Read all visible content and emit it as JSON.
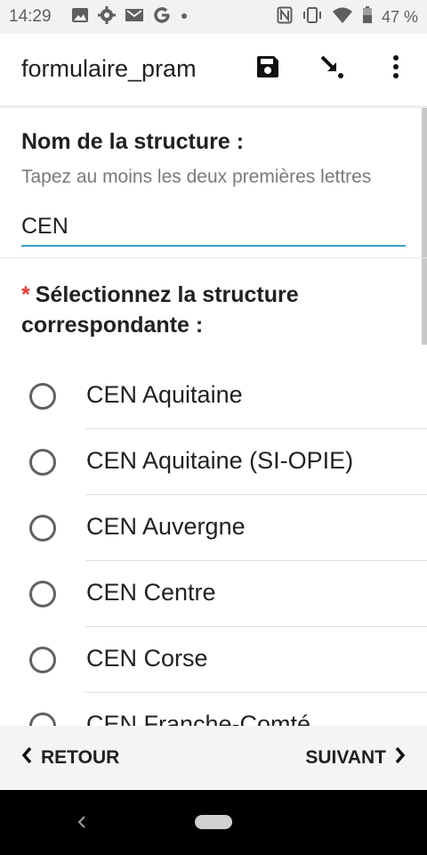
{
  "status_bar": {
    "time": "14:29",
    "battery_percent": "47 %",
    "left_icons": [
      "image-icon",
      "gear-icon",
      "gmail-icon",
      "google-icon",
      "dot-icon"
    ],
    "right_icons": [
      "nfc-icon",
      "vibrate-icon",
      "wifi-icon",
      "battery-icon"
    ]
  },
  "app_bar": {
    "title": "formulaire_pram",
    "actions": [
      "save-icon",
      "jump-to-icon",
      "more-vert-icon"
    ]
  },
  "question1": {
    "label": "Nom de la structure :",
    "hint": "Tapez au moins les deux premières lettres",
    "value": "CEN"
  },
  "question2": {
    "required_marker": "*",
    "label": "Sélectionnez la structure correspondante :",
    "options": [
      {
        "label": "CEN Aquitaine",
        "selected": false
      },
      {
        "label": "CEN Aquitaine (SI-OPIE)",
        "selected": false
      },
      {
        "label": "CEN Auvergne",
        "selected": false
      },
      {
        "label": "CEN Centre",
        "selected": false
      },
      {
        "label": "CEN Corse",
        "selected": false
      },
      {
        "label": "CEN Franche-Comté",
        "selected": false
      }
    ]
  },
  "footer": {
    "back_label": "RETOUR",
    "next_label": "SUIVANT"
  },
  "colors": {
    "accent": "#3d9ec7",
    "required": "#e53935"
  }
}
